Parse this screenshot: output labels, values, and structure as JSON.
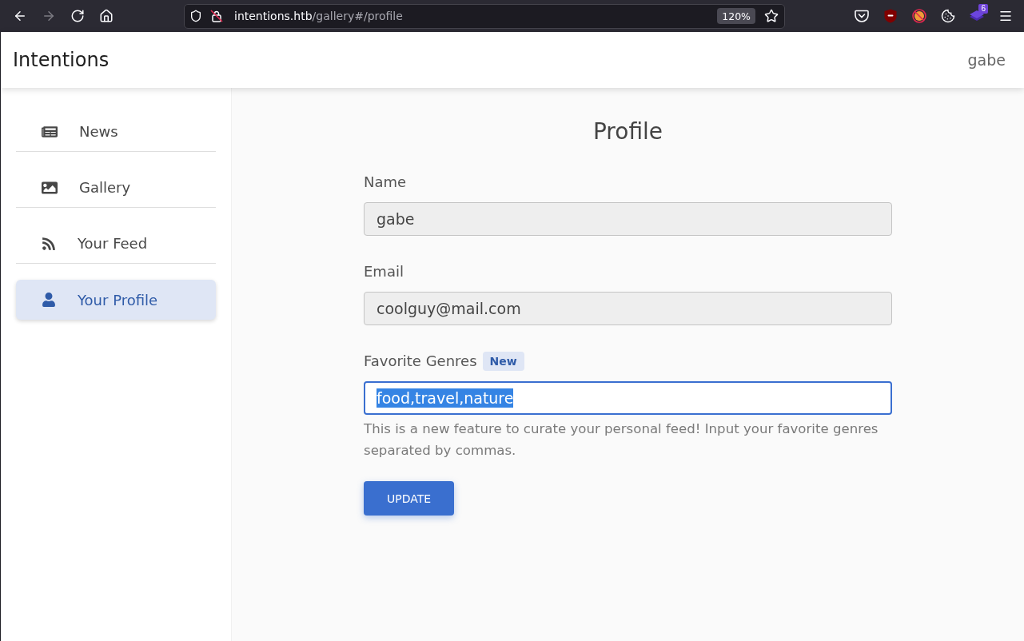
{
  "browser": {
    "nav_buttons": [
      {
        "kind": "back",
        "disabled": false
      },
      {
        "kind": "forward",
        "disabled": true
      },
      {
        "kind": "reload",
        "disabled": false
      },
      {
        "kind": "home",
        "disabled": false
      }
    ],
    "url_host": "intentions.htb",
    "url_path": "/gallery#/profile",
    "zoom": "120%",
    "toolbar_icons": [
      {
        "kind": "chevron_shield"
      },
      {
        "kind": "shield_logo"
      },
      {
        "kind": "blocked"
      },
      {
        "kind": "cookie"
      },
      {
        "kind": "layers",
        "badge": "6"
      },
      {
        "kind": "menu"
      }
    ]
  },
  "navbar": {
    "brand": "Intentions",
    "user": "gabe"
  },
  "sidebar": {
    "items": [
      {
        "kind": "newspaper",
        "label": "News",
        "selected": false
      },
      {
        "kind": "image",
        "label": "Gallery",
        "selected": false
      },
      {
        "kind": "rss",
        "label": "Your Feed",
        "selected": false
      },
      {
        "kind": "user",
        "label": "Your Profile",
        "selected": true
      }
    ]
  },
  "page": {
    "title": "Profile",
    "fields": [
      {
        "label": "Name",
        "value": "gabe",
        "disabled": true,
        "focused": false,
        "text_selected": false
      },
      {
        "label": "Email",
        "value": "coolguy@mail.com",
        "disabled": true,
        "focused": false,
        "text_selected": false
      },
      {
        "label": "Favorite Genres",
        "badge": "New",
        "value": "food,travel,nature",
        "disabled": false,
        "focused": true,
        "text_selected": true,
        "help": "This is a new feature to curate your personal feed! Input your favorite genres separated by commas."
      }
    ],
    "button": "UPDATE"
  }
}
